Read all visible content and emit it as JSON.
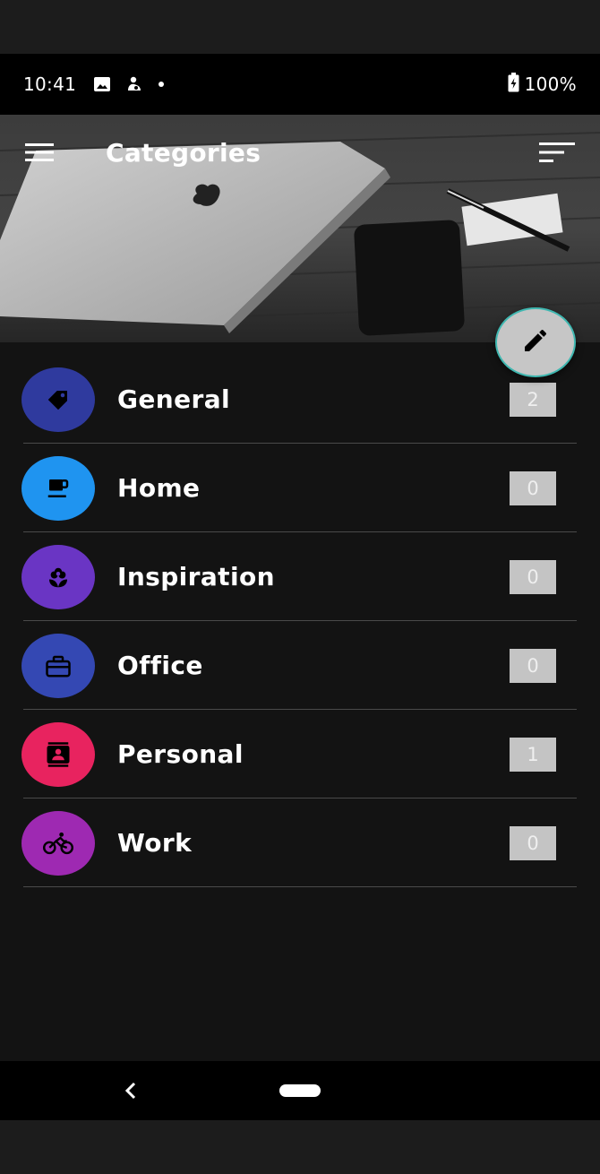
{
  "status_bar": {
    "time": "10:41",
    "battery": "100%",
    "icons": [
      "image-icon",
      "notification-icon",
      "dot-icon",
      "battery-charging-icon"
    ]
  },
  "toolbar": {
    "title": "Categories",
    "menu_icon": "hamburger-menu-icon",
    "sort_icon": "sort-icon"
  },
  "fab": {
    "icon": "pencil-icon"
  },
  "categories": [
    {
      "label": "General",
      "count": "2",
      "color": "#2f3a9e",
      "icon": "tag-icon"
    },
    {
      "label": "Home",
      "count": "0",
      "color": "#1f94f0",
      "icon": "coffee-cup-icon"
    },
    {
      "label": "Inspiration",
      "count": "0",
      "color": "#6a35c4",
      "icon": "flower-icon"
    },
    {
      "label": "Office",
      "count": "0",
      "color": "#3448b3",
      "icon": "briefcase-icon"
    },
    {
      "label": "Personal",
      "count": "1",
      "color": "#e8235f",
      "icon": "contact-card-icon"
    },
    {
      "label": "Work",
      "count": "0",
      "color": "#9e29b2",
      "icon": "bicycle-icon"
    }
  ],
  "nav_bar": {
    "back_icon": "back-chevron-icon",
    "home_icon": "home-pill-icon"
  }
}
